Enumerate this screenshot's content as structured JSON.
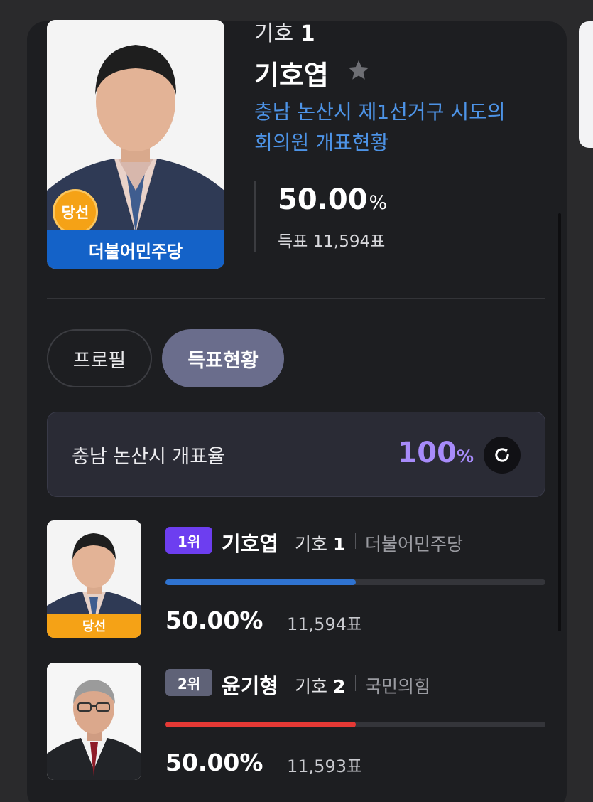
{
  "colors": {
    "page_bg": "#2a2a2c",
    "card_bg": "#1d1e21",
    "accent_purple": "#a78bfa",
    "district_blue": "#4d93e6",
    "party_blue": "#1462c8",
    "party_red": "#e53935",
    "winner_orange": "#f5a216"
  },
  "candidate": {
    "number_prefix": "기호",
    "number": "1",
    "name": "기호엽",
    "district_line1": "충남 논산시 제1선거구 시도의",
    "district_line2": "회의원 개표현황",
    "percent": "50.00",
    "percent_unit": "%",
    "votes": "득표 11,594표",
    "party": "더불어민주당",
    "win_badge": "당선",
    "favorite_icon": "star-icon"
  },
  "tabs": {
    "profile": "프로필",
    "votes": "득표현황"
  },
  "count_rate": {
    "label": "충남 논산시 개표율",
    "value": "100",
    "unit": "%",
    "refresh_icon": "refresh-icon"
  },
  "ranking": [
    {
      "rank": "1위",
      "name": "기호엽",
      "number_prefix": "기호",
      "number": "1",
      "party": "더불어민주당",
      "percent": "50.00%",
      "votes": "11,594표",
      "vote_share": 50.0,
      "win_badge": "당선"
    },
    {
      "rank": "2위",
      "name": "윤기형",
      "number_prefix": "기호",
      "number": "2",
      "party": "국민의힘",
      "percent": "50.00%",
      "votes": "11,593표",
      "vote_share": 50.0
    }
  ]
}
